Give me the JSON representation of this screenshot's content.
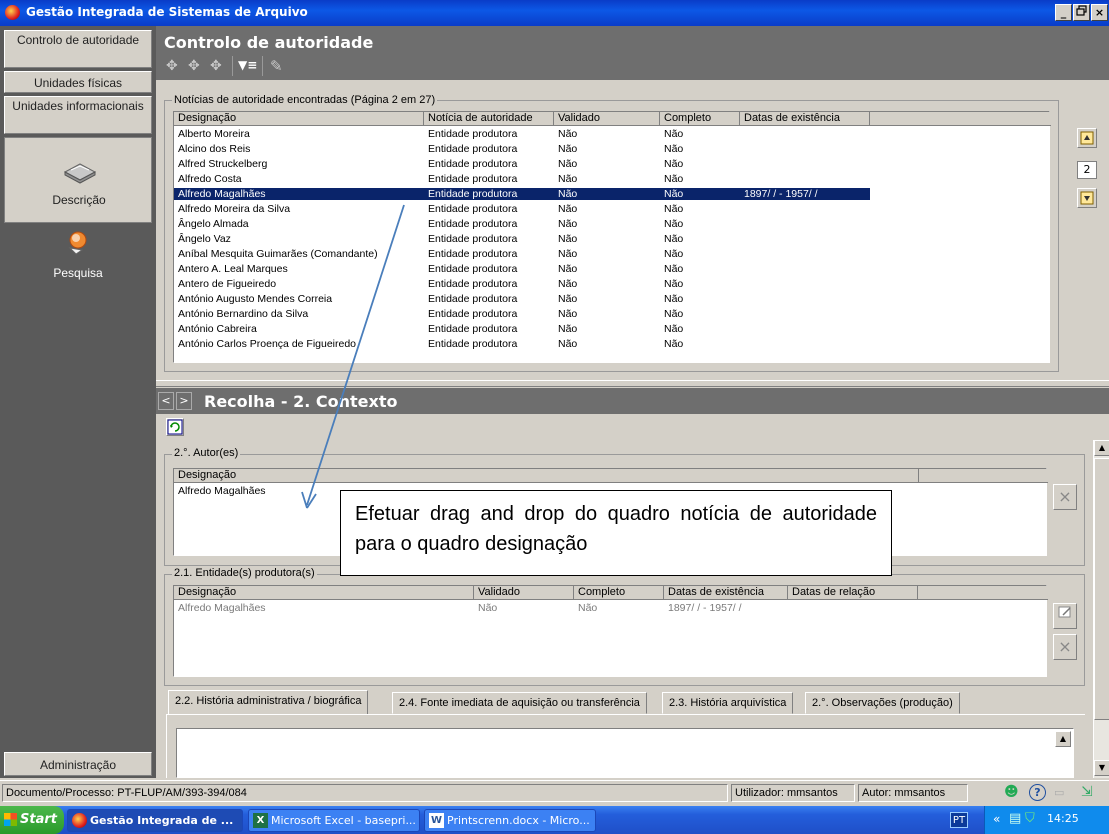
{
  "window": {
    "title": "Gestão Integrada de Sistemas de Arquivo",
    "controls": [
      "_",
      "В",
      "X"
    ]
  },
  "nav": {
    "items": [
      {
        "label": "Controlo de autoridade"
      },
      {
        "label": "Unidades físicas"
      },
      {
        "label": "Unidades informacionais"
      }
    ],
    "descricao": "Descrição",
    "pesquisa": "Pesquisa",
    "admin": "Administração"
  },
  "main": {
    "title": "Controlo de autoridade",
    "group_label": "Notícias de autoridade encontradas (Página 2 em 27)",
    "columns": [
      "Designação",
      "Notícia de autoridade",
      "Validado",
      "Completo",
      "Datas de existência"
    ],
    "rows": [
      {
        "d": "Alberto Moreira",
        "n": "Entidade produtora",
        "v": "Não",
        "c": "Não",
        "e": ""
      },
      {
        "d": "Alcino dos Reis",
        "n": "Entidade produtora",
        "v": "Não",
        "c": "Não",
        "e": ""
      },
      {
        "d": "Alfred Struckelberg",
        "n": "Entidade produtora",
        "v": "Não",
        "c": "Não",
        "e": ""
      },
      {
        "d": "Alfredo Costa",
        "n": "Entidade produtora",
        "v": "Não",
        "c": "Não",
        "e": ""
      },
      {
        "d": "Alfredo Magalhães",
        "n": "Entidade produtora",
        "v": "Não",
        "c": "Não",
        "e": "1897/  /  - 1957/  /",
        "selected": true
      },
      {
        "d": "Alfredo Moreira da Silva",
        "n": "Entidade produtora",
        "v": "Não",
        "c": "Não",
        "e": ""
      },
      {
        "d": "Ângelo Almada",
        "n": "Entidade produtora",
        "v": "Não",
        "c": "Não",
        "e": ""
      },
      {
        "d": "Ângelo Vaz",
        "n": "Entidade produtora",
        "v": "Não",
        "c": "Não",
        "e": ""
      },
      {
        "d": "Aníbal Mesquita Guimarães (Comandante)",
        "n": "Entidade produtora",
        "v": "Não",
        "c": "Não",
        "e": ""
      },
      {
        "d": "Antero A. Leal Marques",
        "n": "Entidade produtora",
        "v": "Não",
        "c": "Não",
        "e": ""
      },
      {
        "d": "Antero de Figueiredo",
        "n": "Entidade produtora",
        "v": "Não",
        "c": "Não",
        "e": ""
      },
      {
        "d": "António Augusto Mendes Correia",
        "n": "Entidade produtora",
        "v": "Não",
        "c": "Não",
        "e": ""
      },
      {
        "d": "António Bernardino da Silva",
        "n": "Entidade produtora",
        "v": "Não",
        "c": "Não",
        "e": ""
      },
      {
        "d": "António Cabreira",
        "n": "Entidade produtora",
        "v": "Não",
        "c": "Não",
        "e": ""
      },
      {
        "d": "António Carlos Proença de Figueiredo",
        "n": "Entidade produtora",
        "v": "Não",
        "c": "Não",
        "e": ""
      }
    ],
    "page_number": "2"
  },
  "context": {
    "title": "Recolha - 2. Contexto",
    "nav_prev": "<",
    "nav_next": ">",
    "autores_label": "2.°. Autor(es)",
    "autores_col": "Designação",
    "autores_rows": [
      "Alfredo Magalhães"
    ],
    "entidades_label": "2.1. Entidade(s) produtora(s)",
    "entidades_cols": [
      "Designação",
      "Validado",
      "Completo",
      "Datas de existência",
      "Datas de relação"
    ],
    "entidades_row": {
      "d": "Alfredo Magalhães",
      "v": "Não",
      "c": "Não",
      "e": "1897/  /  - 1957/  /"
    },
    "tabs": [
      "2.2. História administrativa / biográfica",
      "2.4. Fonte imediata de aquisição ou transferência",
      "2.3. História arquivística",
      "2.°. Observações (produção)"
    ]
  },
  "callout": {
    "text": "Efetuar drag and drop do quadro notícia de autoridade para o quadro designação"
  },
  "status": {
    "documento": "Documento/Processo: PT-FLUP/AM/393-394/084",
    "utilizador": "Utilizador: mmsantos",
    "autor": "Autor: mmsantos"
  },
  "taskbar": {
    "start": "Start",
    "tasks": [
      "Gestão Integrada de ...",
      "Microsoft Excel - basepri...",
      "Printscrenn.docx - Micro..."
    ],
    "lang": "PT",
    "clock": "14:25"
  },
  "colors": {
    "selection": "#0a246a",
    "section_header": "#6e6e6e",
    "nav_background": "#5a5a5a",
    "annotation_arrow": "#4a7ebb"
  }
}
